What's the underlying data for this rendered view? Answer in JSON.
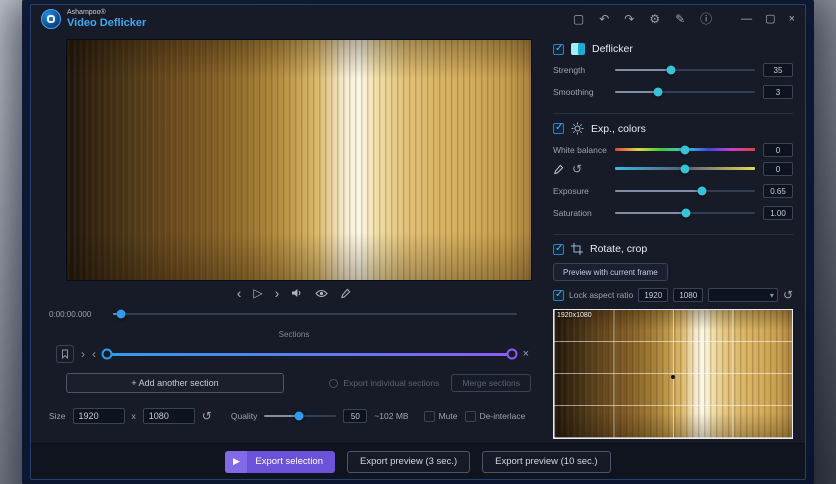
{
  "titlebar": {
    "brand": "Ashampoo®",
    "app_name": "Video Deflicker",
    "tools": {
      "project": "▢",
      "undo": "↶",
      "redo": "↷",
      "settings": "⚙",
      "edit": "✎",
      "info": "ⓘ"
    },
    "window_controls": {
      "minimize": "—",
      "maximize": "▢",
      "close": "×"
    }
  },
  "player": {
    "timecode": "0:00:00.000",
    "prev": "‹",
    "play": "▷",
    "next": "›"
  },
  "sections": {
    "title": "Sections",
    "zoom_in": "›",
    "zoom_out": "‹",
    "remove": "×",
    "add_button": "+  Add another section",
    "export_individual": "Export individual sections",
    "merge": "Merge sections"
  },
  "output": {
    "size_label": "Size",
    "width": "1920",
    "multiply": "x",
    "height": "1080",
    "reset_icon": "↺",
    "quality_label": "Quality",
    "quality": "50",
    "estimate": "~102 MB",
    "mute": "Mute",
    "deinterlace": "De-interlace"
  },
  "export_bar": {
    "selection_icon": "▶",
    "selection": "Export selection",
    "preview_3": "Export preview (3 sec.)",
    "preview_10": "Export preview (10 sec.)"
  },
  "deflicker": {
    "title": "Deflicker",
    "strength_label": "Strength",
    "strength_value": "35",
    "smoothing_label": "Smoothing",
    "smoothing_value": "3"
  },
  "exp_colors": {
    "title": "Exp., colors",
    "white_balance_label": "White balance",
    "white_balance_value": "0",
    "tint_value": "0",
    "reset_icon": "↺",
    "exposure_label": "Exposure",
    "exposure_value": "0.65",
    "saturation_label": "Saturation",
    "saturation_value": "1.00"
  },
  "rotate_crop": {
    "title": "Rotate, crop",
    "preview_button": "Preview with current frame",
    "lock_label": "Lock aspect ratio",
    "crop_width": "1920",
    "crop_height": "1080",
    "dropdown_chevron": "▾",
    "reset_icon": "↺",
    "frame_label": "1920x1080"
  },
  "colors": {
    "accent_blue": "#2f9bf0",
    "accent_teal": "#38c2d8",
    "accent_purple": "#6c52d8"
  }
}
